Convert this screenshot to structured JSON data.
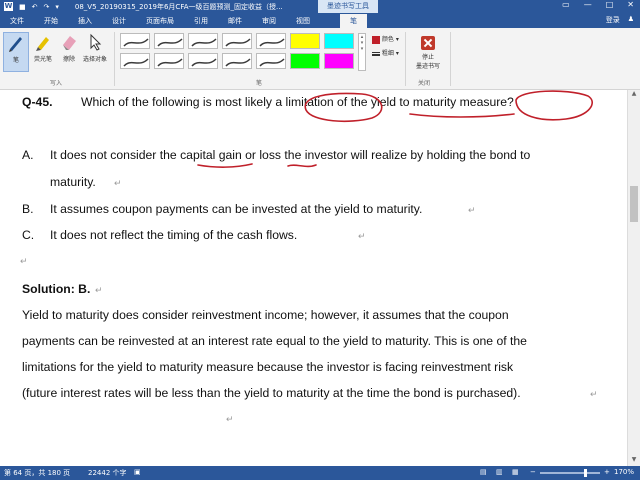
{
  "window": {
    "doc_title": "08_V5_20190315_2019年6月CFA一级百题预测_固定收益（授...",
    "context_tab_header": "墨迹书写工具",
    "sign_in": "登录",
    "quick_access": [
      "↶",
      "↷"
    ]
  },
  "menu": {
    "tabs": [
      "文件",
      "开始",
      "插入",
      "设计",
      "页面布局",
      "引用",
      "邮件",
      "审阅",
      "视图",
      "笔"
    ],
    "active": "笔"
  },
  "ribbon": {
    "tools": [
      "笔",
      "荧光笔",
      "擦除",
      "选择对象"
    ],
    "group_write": "写入",
    "group_pens": "笔",
    "group_close": "关闭",
    "color_label": "颜色",
    "thickness_label": "粗细",
    "stop_label_1": "停止",
    "stop_label_2": "墨迹书写",
    "pen_colors": [
      "#3b3b3b",
      "#3b3b3b",
      "#3b3b3b",
      "#3b3b3b",
      "#3b3b3b",
      "#ffff00",
      "#00ffff",
      "#3b3b3b",
      "#3b3b3b",
      "#3b3b3b",
      "#3b3b3b",
      "#3b3b3b",
      "#00ff00",
      "#ff00ff"
    ]
  },
  "document": {
    "question_number": "Q-45.",
    "question_text": "Which of the following is most likely a limitation of the yield to maturity measure?",
    "options": [
      {
        "letter": "A.",
        "line1": "It does not consider the capital gain or loss the investor will realize by holding the bond to",
        "line2": "maturity."
      },
      {
        "letter": "B.",
        "line1": "It assumes coupon payments can be invested at the yield to maturity."
      },
      {
        "letter": "C.",
        "line1": "It does not reflect the timing of the cash flows."
      }
    ],
    "solution_title": "Solution: B.",
    "solution_lines": [
      "Yield to maturity does consider reinvestment income; however, it assumes that the coupon",
      "payments can be reinvested at an interest rate equal to the yield to maturity. This is one of the",
      "limitations for the yield to maturity measure because the investor is facing reinvestment risk",
      "(future interest rates will be less than the yield to maturity at the time the bond is purchased)."
    ],
    "para_mark": "↵",
    "ink_color": "#c0202a"
  },
  "status": {
    "page": "第 64 页，共 180 页",
    "words": "22442 个字",
    "zoom": "170%",
    "zoom_fraction": 0.75
  }
}
